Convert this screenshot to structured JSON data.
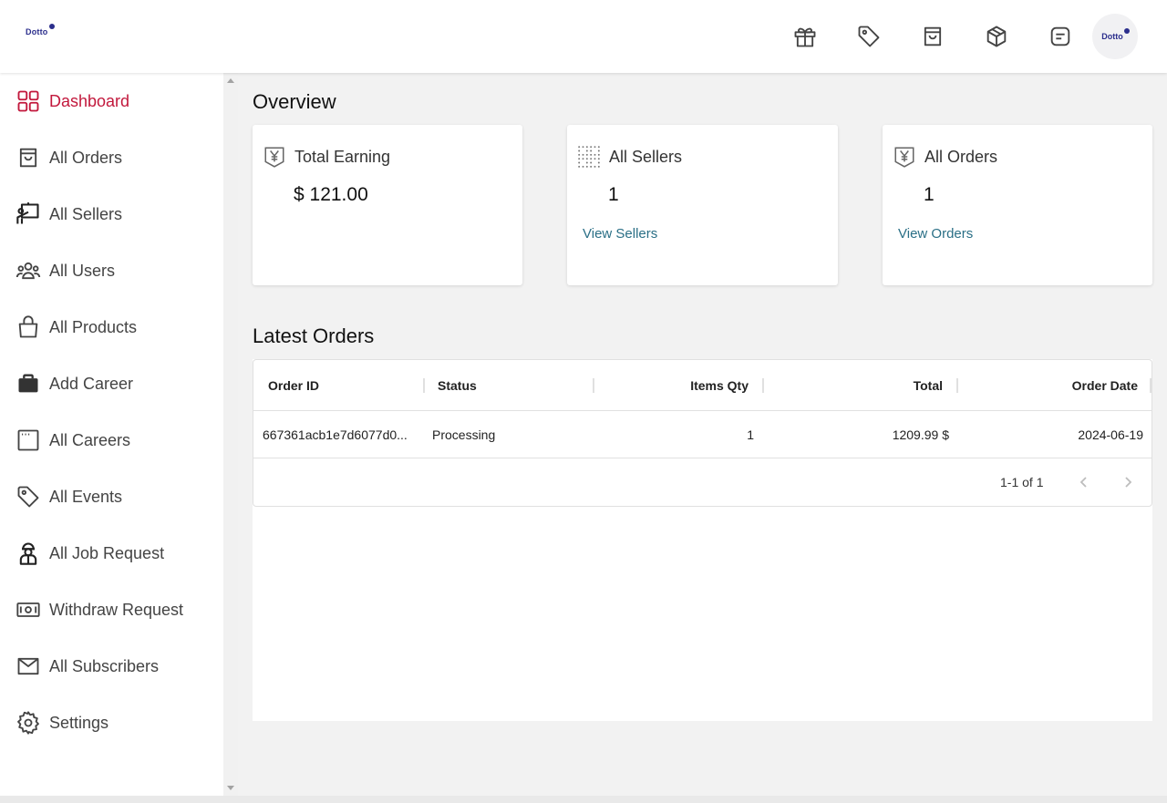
{
  "header": {
    "logo_text": "Dotto",
    "avatar_text": "Dotto",
    "icons": [
      "gift-icon",
      "tag-icon",
      "shopping-bag-icon",
      "package-icon",
      "note-icon"
    ]
  },
  "sidebar": {
    "items": [
      {
        "label": "Dashboard",
        "icon": "dashboard-grid-icon",
        "active": true
      },
      {
        "label": "All Orders",
        "icon": "shopping-bag-icon"
      },
      {
        "label": "All Sellers",
        "icon": "presenter-icon"
      },
      {
        "label": "All Users",
        "icon": "users-icon"
      },
      {
        "label": "All Products",
        "icon": "handbag-icon"
      },
      {
        "label": "Add Career",
        "icon": "briefcase-icon"
      },
      {
        "label": "All Careers",
        "icon": "window-icon"
      },
      {
        "label": "All Events",
        "icon": "tag-icon"
      },
      {
        "label": "All Job Request",
        "icon": "worker-icon"
      },
      {
        "label": "Withdraw Request",
        "icon": "money-icon"
      },
      {
        "label": "All Subscribers",
        "icon": "mail-icon"
      },
      {
        "label": "Settings",
        "icon": "gear-icon"
      }
    ]
  },
  "overview": {
    "title": "Overview",
    "cards": [
      {
        "title": "Total Earning",
        "value": "$ 121.00",
        "link": "",
        "icon": "yen-icon"
      },
      {
        "title": "All Sellers",
        "value": "1",
        "link": "View Sellers",
        "icon": "dotted-grid-icon"
      },
      {
        "title": "All Orders",
        "value": "1",
        "link": "View Orders",
        "icon": "yen-icon"
      }
    ]
  },
  "latest_orders": {
    "title": "Latest Orders",
    "columns": [
      "Order ID",
      "Status",
      "Items Qty",
      "Total",
      "Order Date"
    ],
    "rows": [
      {
        "order_id": "667361acb1e7d6077d0...",
        "status": "Processing",
        "items_qty": "1",
        "total": "1209.99 $",
        "order_date": "2024-06-19"
      }
    ],
    "pagination": "1-1 of 1"
  },
  "colors": {
    "accent": "#c2183c",
    "link": "#2a6f86",
    "brand": "#2b2e8c"
  }
}
